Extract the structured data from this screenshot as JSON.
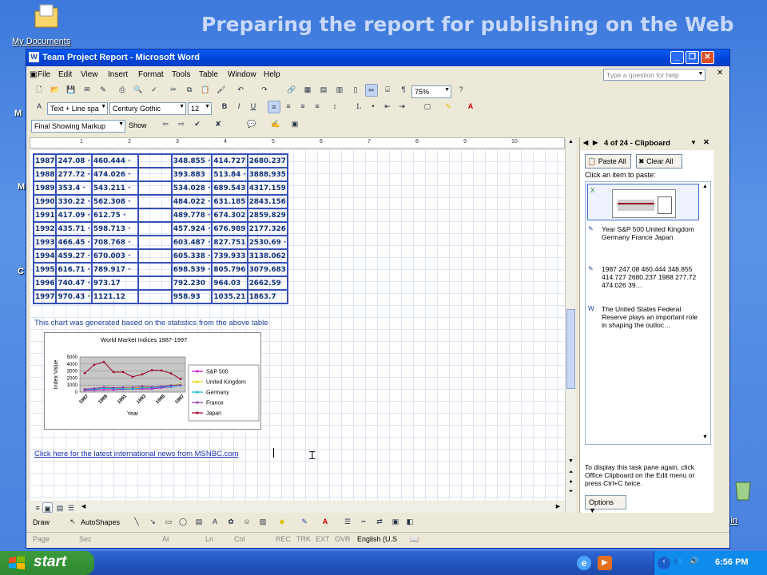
{
  "slide": {
    "title": "Preparing the report for publishing on the Web"
  },
  "desktop": {
    "my_documents": "My Documents",
    "bin_partial": "e Bin"
  },
  "window": {
    "title": "Team Project Report - Microsoft Word",
    "menus": [
      "File",
      "Edit",
      "View",
      "Insert",
      "Format",
      "Tools",
      "Table",
      "Window",
      "Help"
    ],
    "ask_placeholder": "Type a question for help"
  },
  "toolbar": {
    "zoom": "75%",
    "style": "Text + Line spa",
    "font": "Century Gothic",
    "size": "12",
    "bold": "B",
    "italic": "I",
    "underline": "U",
    "markup": "Final Showing Markup",
    "show": "Show"
  },
  "ruler": {
    "ticks": [
      "1",
      "2",
      "3",
      "4",
      "5",
      "6",
      "7",
      "8",
      "9",
      "10"
    ]
  },
  "document": {
    "table_rows": [
      [
        "1987",
        "247.08 ·",
        "460.444 ·",
        "",
        "348.855 ·",
        "414.727",
        "2680.237"
      ],
      [
        "1988",
        "277.72 ·",
        "474.026 ·",
        "",
        "393.883",
        "513.84 ·",
        "3888.935"
      ],
      [
        "1989",
        "353.4 ·",
        "543.211 ·",
        "",
        "534.028 ·",
        "689.543",
        "4317.159"
      ],
      [
        "1990",
        "330.22 ·",
        "562.308 ·",
        "",
        "484.022 ·",
        "631.185",
        "2843.156"
      ],
      [
        "1991",
        "417.09 ·",
        "612.75 ·",
        "",
        "489.778 ·",
        "674.302",
        "2859.829"
      ],
      [
        "1992",
        "435.71 ·",
        "598.713 ·",
        "",
        "457.924 ·",
        "676.989",
        "2177.326"
      ],
      [
        "1993",
        "466.45 ·",
        "708.768 ·",
        "",
        "603.487 ·",
        "827.751",
        "2530.69 ·"
      ],
      [
        "1994",
        "459.27 ·",
        "670.003 ·",
        "",
        "605.338 ·",
        "739.933",
        "3138.062"
      ],
      [
        "1995",
        "616.71 ·",
        "789.917 ·",
        "",
        "698.539 ·",
        "805.796",
        "3079.683"
      ],
      [
        "1996",
        "740.47 ·",
        "973.17",
        "",
        "792.230",
        "964.03",
        "2662.59"
      ],
      [
        "1997",
        "970.43 ·",
        "1121.12",
        "",
        "958.93",
        "1035.21",
        "1863.7"
      ]
    ],
    "caption": "This chart was generated based on the statistics from the above table",
    "link": "Click here for the latest international news from MSNBC.com"
  },
  "chart_data": {
    "type": "line",
    "title": "World Market Indices 1987-1997",
    "xlabel": "Year",
    "ylabel": "Index Value",
    "x": [
      "1987",
      "1988",
      "1989",
      "1990",
      "1991",
      "1992",
      "1993",
      "1994",
      "1995",
      "1996",
      "1997"
    ],
    "x_tick_labels": [
      "1987",
      "1989",
      "1991",
      "1993",
      "1995",
      "1997"
    ],
    "y_ticks": [
      "5000",
      "4000",
      "3000",
      "2000",
      "1000",
      "0"
    ],
    "ylim": [
      0,
      5000
    ],
    "grid": true,
    "legend_position": "right",
    "series": [
      {
        "name": "S&P 500",
        "color": "#cc00cc",
        "values": [
          247.08,
          277.72,
          353.4,
          330.22,
          417.09,
          435.71,
          466.45,
          459.27,
          616.71,
          740.47,
          970.43
        ]
      },
      {
        "name": "United Kingdom",
        "color": "#e6d600",
        "values": [
          460.444,
          474.026,
          543.211,
          562.308,
          612.75,
          598.713,
          708.768,
          670.003,
          789.917,
          973.17,
          1121.12
        ]
      },
      {
        "name": "Germany",
        "color": "#00bcd4",
        "values": [
          348.855,
          393.883,
          534.028,
          484.022,
          489.778,
          457.924,
          603.487,
          605.338,
          698.539,
          792.23,
          958.93
        ]
      },
      {
        "name": "France",
        "color": "#8833aa",
        "values": [
          414.727,
          513.84,
          689.543,
          631.185,
          674.302,
          676.989,
          827.751,
          739.933,
          805.796,
          964.03,
          1035.21
        ]
      },
      {
        "name": "Japan",
        "color": "#990022",
        "values": [
          2680.237,
          3888.935,
          4317.159,
          2843.156,
          2859.829,
          2177.326,
          2530.69,
          3138.062,
          3079.683,
          2662.59,
          1863.7
        ]
      }
    ]
  },
  "clipboard": {
    "header": "4 of 24 - Clipboard",
    "paste_all": "Paste All",
    "clear_all": "Clear All",
    "instruction": "Click an item to paste:",
    "items": [
      "Year S&P 500 United Kingdom Germany France Japan",
      "1987 247.08 460.444 348.855 414.727 2680.237 1988 277.72 474.026 39…",
      "The United States Federal Reserve plays an important role in shaping the outloc…"
    ],
    "footer": "To display this task pane again, click Office Clipboard on the Edit menu or press Ctrl+C twice.",
    "options": "Options"
  },
  "drawbar": {
    "draw": "Draw",
    "autoshapes": "AutoShapes"
  },
  "status": {
    "page": "Page",
    "sec": "Sec",
    "at": "At",
    "ln": "Ln",
    "col": "Col",
    "rec": "REC",
    "trk": "TRK",
    "ext": "EXT",
    "ovr": "OVR",
    "lang": "English (U.S"
  },
  "taskbar": {
    "start": "start",
    "clock": "6:56 PM"
  }
}
